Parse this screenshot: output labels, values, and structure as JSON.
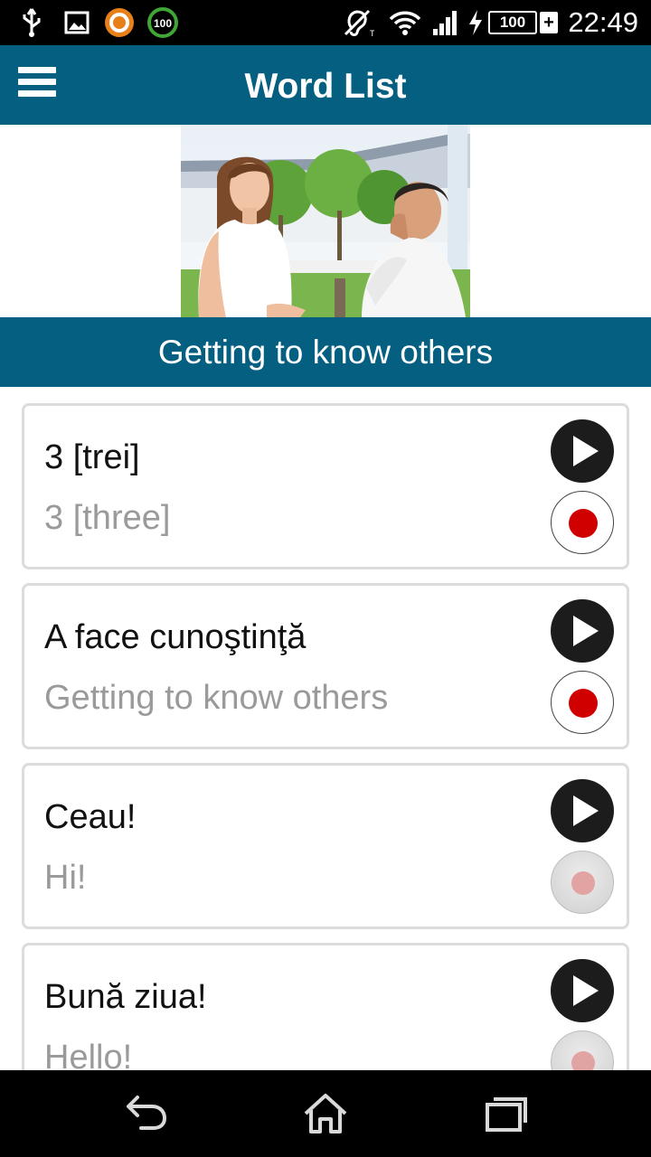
{
  "status_bar": {
    "time": "22:49",
    "battery": "100",
    "badge_100": "100",
    "icons": [
      "usb-icon",
      "image-icon",
      "app-a-icon",
      "progress-100-icon",
      "hearing-aid-icon",
      "wifi-icon",
      "signal-icon",
      "charging-icon",
      "battery-icon"
    ]
  },
  "header": {
    "title": "Word List",
    "menu_icon": "hamburger-menu-icon"
  },
  "category": {
    "title": "Getting to know others"
  },
  "words": [
    {
      "native": "3 [trei]",
      "translation": "3 [three]",
      "record_enabled": true
    },
    {
      "native": "A face cunoştinţă",
      "translation": "Getting to know others",
      "record_enabled": true
    },
    {
      "native": "Ceau!",
      "translation": "Hi!",
      "record_enabled": false
    },
    {
      "native": "Bună ziua!",
      "translation": "Hello!",
      "record_enabled": false
    }
  ],
  "nav_bar": {
    "icons": [
      "back-icon",
      "home-icon",
      "recent-apps-icon"
    ]
  },
  "colors": {
    "primary": "#045f80",
    "record": "#d00000",
    "translation_text": "#9a9a9a"
  }
}
